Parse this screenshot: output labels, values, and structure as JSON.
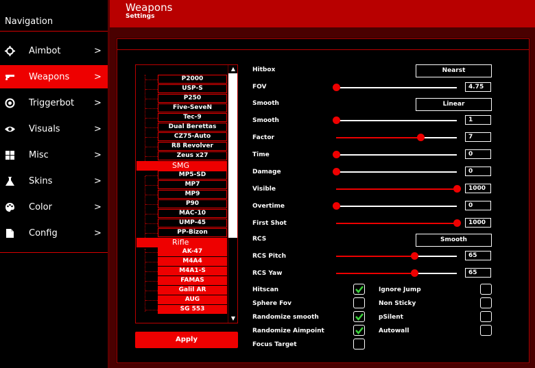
{
  "sidebar": {
    "title": "Navigation",
    "items": [
      {
        "label": "Aimbot",
        "icon": "crosshair-icon",
        "chevron": ">"
      },
      {
        "label": "Weapons",
        "icon": "gun-icon",
        "chevron": ">"
      },
      {
        "label": "Triggerbot",
        "icon": "target-icon",
        "chevron": ">"
      },
      {
        "label": "Visuals",
        "icon": "eye-icon",
        "chevron": ">"
      },
      {
        "label": "Misc",
        "icon": "grid-icon",
        "chevron": ">"
      },
      {
        "label": "Skins",
        "icon": "flask-icon",
        "chevron": ">"
      },
      {
        "label": "Color",
        "icon": "palette-icon",
        "chevron": ">"
      },
      {
        "label": "Config",
        "icon": "file-icon",
        "chevron": ">"
      }
    ],
    "active_index": 1
  },
  "header": {
    "title": "Weapons",
    "subtitle": "Settings"
  },
  "weapon_list": {
    "pistols": [
      "P2000",
      "USP-S",
      "P250",
      "Five-SeveN",
      "Tec-9",
      "Dual Berettas",
      "CZ75-Auto",
      "R8 Revolver",
      "Zeus x27"
    ],
    "smg_category": "SMG",
    "smgs": [
      "MP5-SD",
      "MP7",
      "MP9",
      "P90",
      "MAC-10",
      "UMP-45",
      "PP-Bizon"
    ],
    "rifle_category": "Rifle",
    "rifles": [
      "AK-47",
      "M4A4",
      "M4A1-S",
      "FAMAS",
      "Galil AR",
      "AUG",
      "SG 553"
    ]
  },
  "apply_label": "Apply",
  "settings": {
    "hitbox": {
      "label": "Hitbox",
      "value": "Nearst"
    },
    "fov": {
      "label": "FOV",
      "value": "4.75",
      "level": 0.0
    },
    "smooth_mode": {
      "label": "Smooth",
      "value": "Linear"
    },
    "smooth": {
      "label": "Smooth",
      "value": "1",
      "level": 0.0
    },
    "factor": {
      "label": "Factor",
      "value": "7",
      "level": 0.7
    },
    "time": {
      "label": "Time",
      "value": "0",
      "level": 0.0
    },
    "damage": {
      "label": "Damage",
      "value": "0",
      "level": 0.0
    },
    "visible": {
      "label": "Visible",
      "value": "1000",
      "level": 1.0
    },
    "overtime": {
      "label": "Overtime",
      "value": "0",
      "level": 0.0
    },
    "first_shot": {
      "label": "First Shot",
      "value": "1000",
      "level": 1.0
    },
    "rcs": {
      "label": "RCS",
      "value": "Smooth"
    },
    "rcs_pitch": {
      "label": "RCS Pitch",
      "value": "65",
      "level": 0.65
    },
    "rcs_yaw": {
      "label": "RCS Yaw",
      "value": "65",
      "level": 0.65
    }
  },
  "checkboxes_left": [
    {
      "label": "Hitscan",
      "checked": true
    },
    {
      "label": "Sphere Fov",
      "checked": false
    },
    {
      "label": "Randomize smooth",
      "checked": true
    },
    {
      "label": "Randomize Aimpoint",
      "checked": true
    },
    {
      "label": "Focus Target",
      "checked": false
    }
  ],
  "checkboxes_right": [
    {
      "label": "Ignore Jump",
      "checked": false
    },
    {
      "label": "Non Sticky",
      "checked": false
    },
    {
      "label": "pSilent",
      "checked": false
    },
    {
      "label": "Autowall",
      "checked": false
    }
  ],
  "colors": {
    "accent": "#ee0000",
    "header": "#b80000",
    "background": "#000000"
  }
}
